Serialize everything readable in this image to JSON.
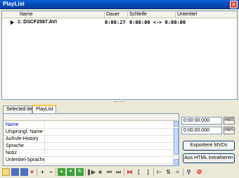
{
  "window": {
    "title": "PlayList"
  },
  "playlist": {
    "columns": {
      "name": "Name",
      "duration": "Dauer",
      "loop": "Schleife",
      "subtitle": "Untertitel"
    },
    "items": [
      {
        "name": "1: DSCF2587.AVI",
        "duration": "0:00:27",
        "loop": "0:00:00 <-> 0:00:00",
        "subtitle": ""
      }
    ]
  },
  "tabs": [
    {
      "label": "Selected item",
      "active": false
    },
    {
      "label": "PlayList",
      "active": true
    }
  ],
  "properties": {
    "rows": [
      "Name",
      "Ursprüngl. Name",
      "Aufrufe-History",
      "Sprache",
      "Notiz",
      "Untertitel-Sprache"
    ]
  },
  "time": {
    "start": "0:00:00.000",
    "end": "0:00:00.000",
    "hms_label": "HMS"
  },
  "buttons": {
    "export_mvd": "Exportiere MVDs",
    "extract_html": "Aus HTML extrahieren"
  },
  "colors": {
    "titlebar": "#0a5fd8",
    "name_accent": "#0000cc",
    "tab_accent": "#ffc83c"
  }
}
